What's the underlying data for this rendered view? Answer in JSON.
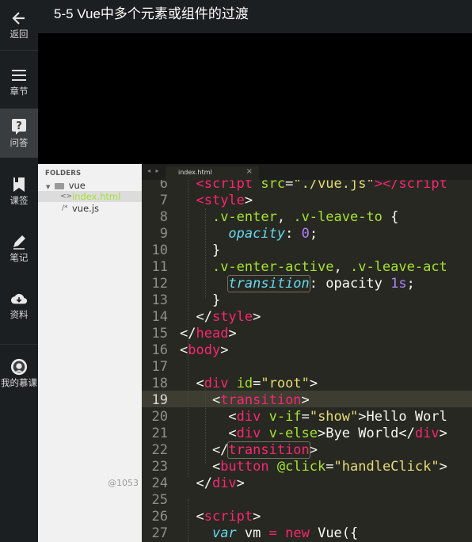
{
  "nav": [
    {
      "icon": "back-arrow-icon",
      "label": "返回"
    },
    {
      "icon": "list-icon",
      "label": "章节"
    },
    {
      "icon": "question-icon",
      "label": "问答"
    },
    {
      "icon": "bookmark-icon",
      "label": "课签"
    },
    {
      "icon": "pencil-icon",
      "label": "笔记"
    },
    {
      "icon": "download-icon",
      "label": "资料"
    },
    {
      "icon": "mooc-logo-icon",
      "label": "我的慕课"
    }
  ],
  "header": {
    "title": "5-5 Vue中多个元素或组件的过渡"
  },
  "sidebar": {
    "folders_label": "FOLDERS",
    "folder": "vue",
    "files": [
      "index.html",
      "vue.js"
    ]
  },
  "watermark": "@1053",
  "tab": {
    "name": "index.html",
    "close": "×",
    "arrows": "◂ ▸"
  },
  "colors": {
    "accent": "#f92672",
    "background": "#272822",
    "sidebar": "#f1f1f1"
  },
  "code": {
    "line_numbers": [
      "6",
      "7",
      "8",
      "9",
      "10",
      "11",
      "12",
      "13",
      "14",
      "15",
      "16",
      "17",
      "18",
      "19",
      "20",
      "21",
      "22",
      "23",
      "24",
      "25",
      "26",
      "27"
    ],
    "current_line": "19"
  }
}
